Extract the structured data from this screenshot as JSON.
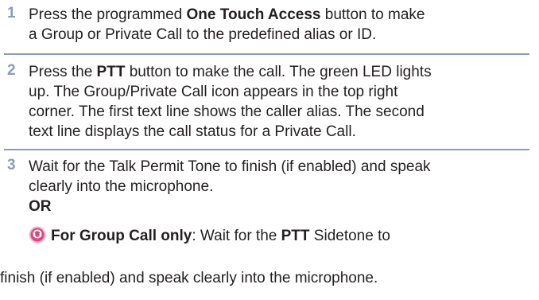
{
  "steps": [
    {
      "number": "1",
      "lines": [
        {
          "t1": "Press the programmed ",
          "b1": "One Touch Access",
          "t2": " button to make"
        },
        {
          "t1": "a Group or Private Call to the predefined alias or ID."
        }
      ]
    },
    {
      "number": "2",
      "lines": [
        {
          "t1": "Press the ",
          "b1": "PTT",
          "t2": " button to make the call. The green LED lights"
        },
        {
          "t1": "up. The Group/Private Call icon appears in the top right"
        },
        {
          "t1": "corner. The first text line shows the caller alias. The second"
        },
        {
          "t1": "text line displays the call status for a Private Call."
        }
      ]
    },
    {
      "number": "3",
      "lines": [
        {
          "t1": "Wait for the Talk Permit Tone to finish (if enabled) and speak"
        },
        {
          "t1": "clearly into the microphone."
        },
        {
          "b1": "OR"
        }
      ],
      "alt": {
        "icon": "group-call-icon",
        "bold_lead": "For Group Call only",
        "t1": ": Wait for the ",
        "b1": "PTT",
        "t2": " Sidetone to",
        "line2": "finish (if enabled) and speak clearly into the microphone."
      }
    }
  ],
  "colors": {
    "accent": "#8d9bb7",
    "icon": "#e0457b"
  }
}
